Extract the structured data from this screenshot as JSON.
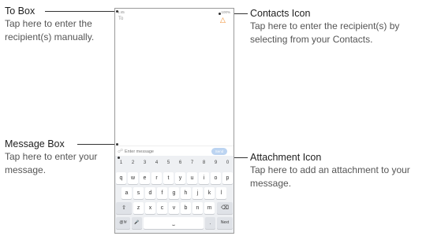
{
  "callouts": {
    "to_box": {
      "title": "To Box",
      "desc": "Tap here to enter the recipient(s) manually."
    },
    "message_box": {
      "title": "Message Box",
      "desc": "Tap here to enter your message."
    },
    "contacts_icon": {
      "title": "Contacts Icon",
      "desc": "Tap here to enter the recipient(s) by selecting from your Contacts."
    },
    "attachment_icon": {
      "title": "Attachment Icon",
      "desc": "Tap here to add an attachment to your message."
    }
  },
  "phone": {
    "status_left": "1:45",
    "status_right": "100%",
    "to_label": "To",
    "message_placeholder": "Enter message",
    "send_label": "Send",
    "contacts_icon": "contacts-icon",
    "attach_icon": "paperclip-icon"
  },
  "keyboard": {
    "number_row": [
      "1",
      "2",
      "3",
      "4",
      "5",
      "6",
      "7",
      "8",
      "9",
      "0"
    ],
    "row1": [
      "q",
      "w",
      "e",
      "r",
      "t",
      "y",
      "u",
      "i",
      "o",
      "p"
    ],
    "row2": [
      "a",
      "s",
      "d",
      "f",
      "g",
      "h",
      "j",
      "k",
      "l"
    ],
    "row3": [
      "z",
      "x",
      "c",
      "v",
      "b",
      "n",
      "m"
    ],
    "shift": "⇧",
    "backspace": "⌫",
    "sym": "@!#",
    "mic": "🎤",
    "space": "⎵",
    "period": ".",
    "next": "Next"
  }
}
